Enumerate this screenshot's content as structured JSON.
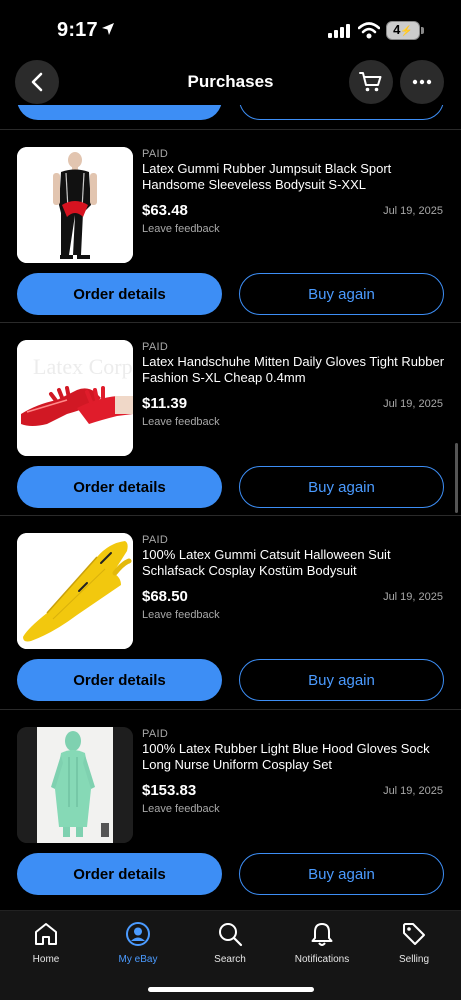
{
  "status_bar": {
    "time": "9:17",
    "battery": "4"
  },
  "header": {
    "title": "Purchases"
  },
  "orders": [
    {
      "status": "PAID",
      "title": "Latex Gummi Rubber Jumpsuit Black Sport Handsome Sleeveless Bodysuit S-XXL",
      "price": "$63.48",
      "date": "Jul 19, 2025",
      "feedback": "Leave feedback",
      "order_label": "Order details",
      "buy_label": "Buy again"
    },
    {
      "status": "PAID",
      "title": "Latex Handschuhe Mitten Daily Gloves Tight Rubber Fashion S-XL Cheap 0.4mm",
      "price": "$11.39",
      "date": "Jul 19, 2025",
      "feedback": "Leave feedback",
      "order_label": "Order details",
      "buy_label": "Buy again"
    },
    {
      "status": "PAID",
      "title": "100% Latex Gummi Catsuit Halloween Suit Schlafsack Cosplay Kostüm Bodysuit",
      "price": "$68.50",
      "date": "Jul 19, 2025",
      "feedback": "Leave feedback",
      "order_label": "Order details",
      "buy_label": "Buy again"
    },
    {
      "status": "PAID",
      "title": "100% Latex Rubber Light Blue Hood Gloves Sock Long Nurse Uniform Cosplay Set",
      "price": "$153.83",
      "date": "Jul 19, 2025",
      "feedback": "Leave feedback",
      "order_label": "Order details",
      "buy_label": "Buy again"
    }
  ],
  "thumb_watermark": "Latex Corp",
  "tabs": [
    {
      "label": "Home",
      "icon": "home-icon",
      "active": false
    },
    {
      "label": "My eBay",
      "icon": "user-icon",
      "active": true
    },
    {
      "label": "Search",
      "icon": "search-icon",
      "active": false
    },
    {
      "label": "Notifications",
      "icon": "bell-icon",
      "active": false
    },
    {
      "label": "Selling",
      "icon": "tag-icon",
      "active": false
    }
  ],
  "colors": {
    "accent": "#3d8ef5",
    "accent_text": "#4b9bff",
    "background": "#000000",
    "muted": "#a8a8a8"
  }
}
